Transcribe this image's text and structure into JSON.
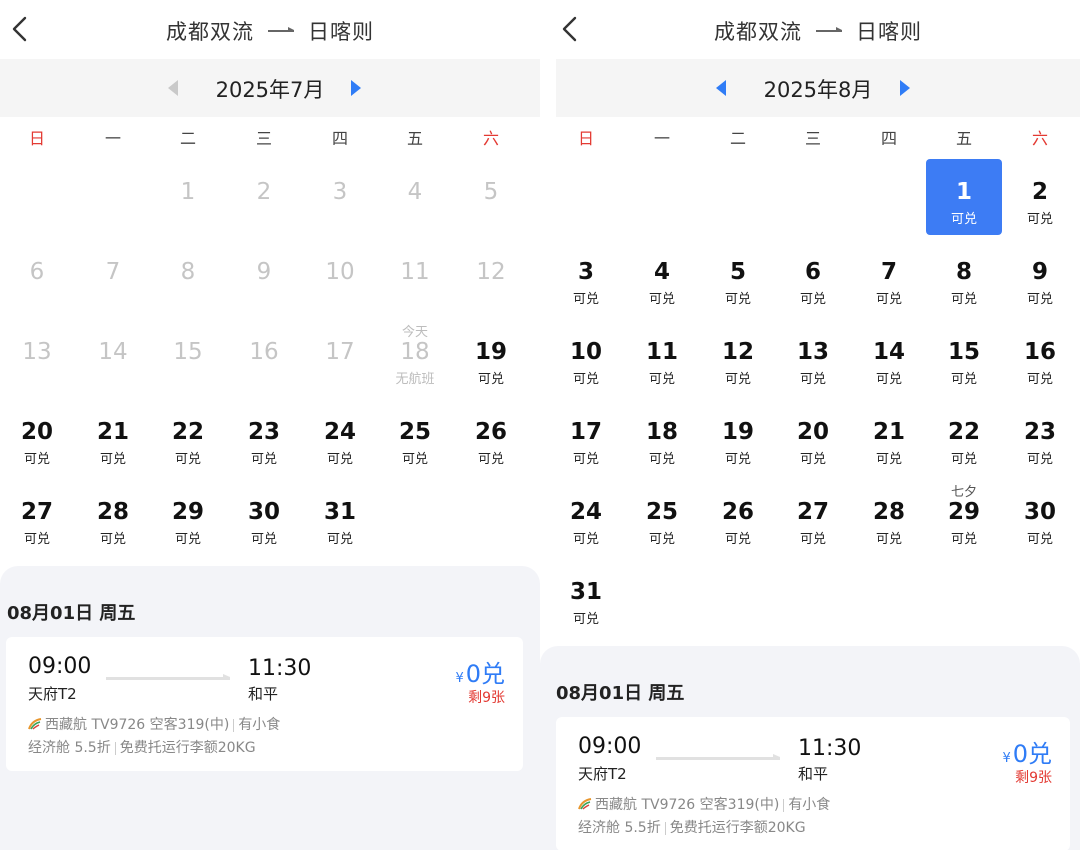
{
  "colors": {
    "accent": "#2f7cf6",
    "selected_bg": "#3d7cf4",
    "weekend": "#e33a33",
    "muted": "#c5c5c5"
  },
  "left": {
    "header": {
      "from": "成都双流",
      "to": "日喀则"
    },
    "month": {
      "label": "2025年7月"
    },
    "weekdays": [
      "日",
      "一",
      "二",
      "三",
      "四",
      "五",
      "六"
    ],
    "days": [
      {
        "n": "1",
        "s": "",
        "t": "",
        "d": true
      },
      {
        "n": "2",
        "s": "",
        "t": "",
        "d": true
      },
      {
        "n": "3",
        "s": "",
        "t": "",
        "d": true
      },
      {
        "n": "4",
        "s": "",
        "t": "",
        "d": true
      },
      {
        "n": "5",
        "s": "",
        "t": "",
        "d": true
      },
      {
        "n": "6",
        "s": "",
        "t": "",
        "d": true
      },
      {
        "n": "7",
        "s": "",
        "t": "",
        "d": true
      },
      {
        "n": "8",
        "s": "",
        "t": "",
        "d": true
      },
      {
        "n": "9",
        "s": "",
        "t": "",
        "d": true
      },
      {
        "n": "10",
        "s": "",
        "t": "",
        "d": true
      },
      {
        "n": "11",
        "s": "",
        "t": "",
        "d": true
      },
      {
        "n": "12",
        "s": "",
        "t": "",
        "d": true
      },
      {
        "n": "13",
        "s": "",
        "t": "",
        "d": true
      },
      {
        "n": "14",
        "s": "",
        "t": "",
        "d": true
      },
      {
        "n": "15",
        "s": "",
        "t": "",
        "d": true
      },
      {
        "n": "16",
        "s": "",
        "t": "",
        "d": true
      },
      {
        "n": "17",
        "s": "",
        "t": "",
        "d": true
      },
      {
        "n": "18",
        "s": "无航班",
        "t": "今天",
        "d": true
      },
      {
        "n": "19",
        "s": "可兑",
        "t": "",
        "d": false
      },
      {
        "n": "20",
        "s": "可兑",
        "t": "",
        "d": false
      },
      {
        "n": "21",
        "s": "可兑",
        "t": "",
        "d": false
      },
      {
        "n": "22",
        "s": "可兑",
        "t": "",
        "d": false
      },
      {
        "n": "23",
        "s": "可兑",
        "t": "",
        "d": false
      },
      {
        "n": "24",
        "s": "可兑",
        "t": "",
        "d": false
      },
      {
        "n": "25",
        "s": "可兑",
        "t": "",
        "d": false
      },
      {
        "n": "26",
        "s": "可兑",
        "t": "",
        "d": false
      },
      {
        "n": "27",
        "s": "可兑",
        "t": "",
        "d": false
      },
      {
        "n": "28",
        "s": "可兑",
        "t": "",
        "d": false
      },
      {
        "n": "29",
        "s": "可兑",
        "t": "",
        "d": false
      },
      {
        "n": "30",
        "s": "可兑",
        "t": "",
        "d": false
      },
      {
        "n": "31",
        "s": "可兑",
        "t": "",
        "d": false
      }
    ],
    "selected_date": "08月01日 周五",
    "flight": {
      "dep_time": "09:00",
      "dep_airport": "天府T2",
      "arr_time": "11:30",
      "arr_airport": "和平",
      "price_symbol": "¥",
      "price": "0兑",
      "remaining": "剩9张",
      "airline_info": "西藏航 TV9726 空客319(中)",
      "meal": "有小食",
      "cabin": "经济舱 5.5折",
      "baggage": "免费托运行李额20KG"
    }
  },
  "right": {
    "header": {
      "from": "成都双流",
      "to": "日喀则"
    },
    "month": {
      "label": "2025年8月"
    },
    "weekdays": [
      "日",
      "一",
      "二",
      "三",
      "四",
      "五",
      "六"
    ],
    "days": [
      {
        "n": "1",
        "s": "可兑",
        "t": "",
        "d": false,
        "sel": true
      },
      {
        "n": "2",
        "s": "可兑",
        "t": "",
        "d": false
      },
      {
        "n": "3",
        "s": "可兑",
        "t": "",
        "d": false
      },
      {
        "n": "4",
        "s": "可兑",
        "t": "",
        "d": false
      },
      {
        "n": "5",
        "s": "可兑",
        "t": "",
        "d": false
      },
      {
        "n": "6",
        "s": "可兑",
        "t": "",
        "d": false
      },
      {
        "n": "7",
        "s": "可兑",
        "t": "",
        "d": false
      },
      {
        "n": "8",
        "s": "可兑",
        "t": "",
        "d": false
      },
      {
        "n": "9",
        "s": "可兑",
        "t": "",
        "d": false
      },
      {
        "n": "10",
        "s": "可兑",
        "t": "",
        "d": false
      },
      {
        "n": "11",
        "s": "可兑",
        "t": "",
        "d": false
      },
      {
        "n": "12",
        "s": "可兑",
        "t": "",
        "d": false
      },
      {
        "n": "13",
        "s": "可兑",
        "t": "",
        "d": false
      },
      {
        "n": "14",
        "s": "可兑",
        "t": "",
        "d": false
      },
      {
        "n": "15",
        "s": "可兑",
        "t": "",
        "d": false
      },
      {
        "n": "16",
        "s": "可兑",
        "t": "",
        "d": false
      },
      {
        "n": "17",
        "s": "可兑",
        "t": "",
        "d": false
      },
      {
        "n": "18",
        "s": "可兑",
        "t": "",
        "d": false
      },
      {
        "n": "19",
        "s": "可兑",
        "t": "",
        "d": false
      },
      {
        "n": "20",
        "s": "可兑",
        "t": "",
        "d": false
      },
      {
        "n": "21",
        "s": "可兑",
        "t": "",
        "d": false
      },
      {
        "n": "22",
        "s": "可兑",
        "t": "",
        "d": false
      },
      {
        "n": "23",
        "s": "可兑",
        "t": "",
        "d": false
      },
      {
        "n": "24",
        "s": "可兑",
        "t": "",
        "d": false
      },
      {
        "n": "25",
        "s": "可兑",
        "t": "",
        "d": false
      },
      {
        "n": "26",
        "s": "可兑",
        "t": "",
        "d": false
      },
      {
        "n": "27",
        "s": "可兑",
        "t": "",
        "d": false
      },
      {
        "n": "28",
        "s": "可兑",
        "t": "",
        "d": false
      },
      {
        "n": "29",
        "s": "可兑",
        "t": "七夕",
        "d": false
      },
      {
        "n": "30",
        "s": "可兑",
        "t": "",
        "d": false
      },
      {
        "n": "31",
        "s": "可兑",
        "t": "",
        "d": false
      }
    ],
    "selected_date": "08月01日 周五",
    "flight": {
      "dep_time": "09:00",
      "dep_airport": "天府T2",
      "arr_time": "11:30",
      "arr_airport": "和平",
      "price_symbol": "¥",
      "price": "0兑",
      "remaining": "剩9张",
      "airline_info": "西藏航 TV9726 空客319(中)",
      "meal": "有小食",
      "cabin": "经济舱 5.5折",
      "baggage": "免费托运行李额20KG"
    }
  }
}
